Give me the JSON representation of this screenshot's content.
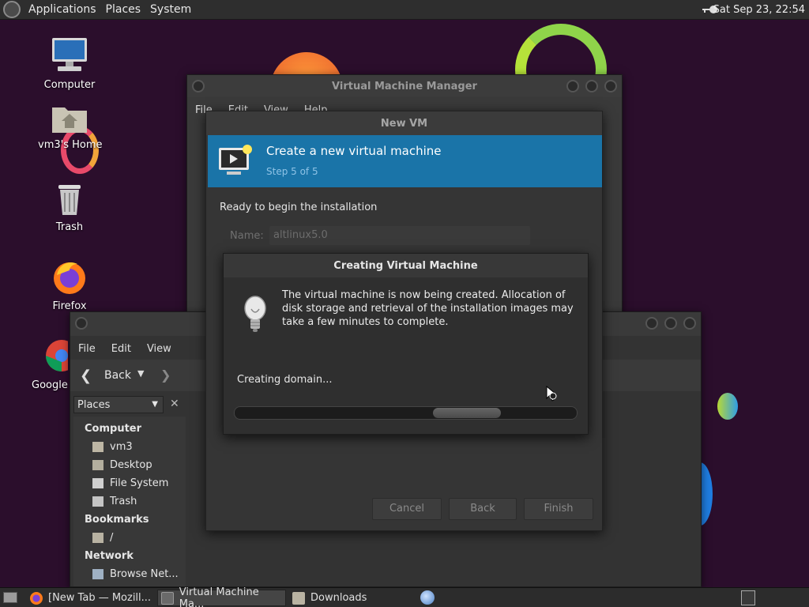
{
  "top_panel": {
    "menus": [
      "Applications",
      "Places",
      "System"
    ],
    "clock": "Sat Sep 23, 22:54"
  },
  "desktop_icons": [
    {
      "label": "Computer",
      "icon": "computer-icon"
    },
    {
      "label": "vm3's Home",
      "icon": "home-folder-icon"
    },
    {
      "label": "Trash",
      "icon": "trash-icon"
    },
    {
      "label": "Firefox",
      "icon": "firefox-icon"
    },
    {
      "label": "Google",
      "icon": "chrome-icon"
    }
  ],
  "vmm_window": {
    "title": "Virtual Machine Manager",
    "menus": [
      "File",
      "Edit",
      "View",
      "Help"
    ]
  },
  "new_vm_dialog": {
    "title": "New VM",
    "banner_title": "Create a new virtual machine",
    "banner_step": "Step 5 of 5",
    "ready_text": "Ready to begin the installation",
    "name_label": "Name:",
    "name_value": "altlinux5.0",
    "buttons": {
      "cancel": "Cancel",
      "back": "Back",
      "finish": "Finish"
    }
  },
  "progress_dialog": {
    "title": "Creating Virtual Machine",
    "message": "The virtual machine is now being created. Allocation of disk storage and retrieval of the installation images may take a few minutes to complete.",
    "status": "Creating domain...",
    "icon": "lightbulb-icon"
  },
  "file_manager": {
    "menus": [
      "File",
      "Edit",
      "View"
    ],
    "back_label": "Back",
    "places_label": "Places",
    "sections": {
      "computer": "Computer",
      "bookmarks": "Bookmarks",
      "network": "Network"
    },
    "computer_items": [
      "vm3",
      "Desktop",
      "File System",
      "Trash"
    ],
    "bookmark_items": [
      "/"
    ],
    "network_items": [
      "Browse Net..."
    ]
  },
  "taskbar": {
    "tasks": [
      {
        "label": "[New Tab — Mozill...",
        "icon": "firefox-icon"
      },
      {
        "label": "Virtual Machine Ma...",
        "icon": "vmm-icon"
      },
      {
        "label": "Downloads",
        "icon": "folder-icon"
      }
    ]
  },
  "colors": {
    "desktop_bg": "#2b0e2c",
    "banner_bg": "#1a74a8",
    "panel_bg": "#2e2e2e"
  }
}
